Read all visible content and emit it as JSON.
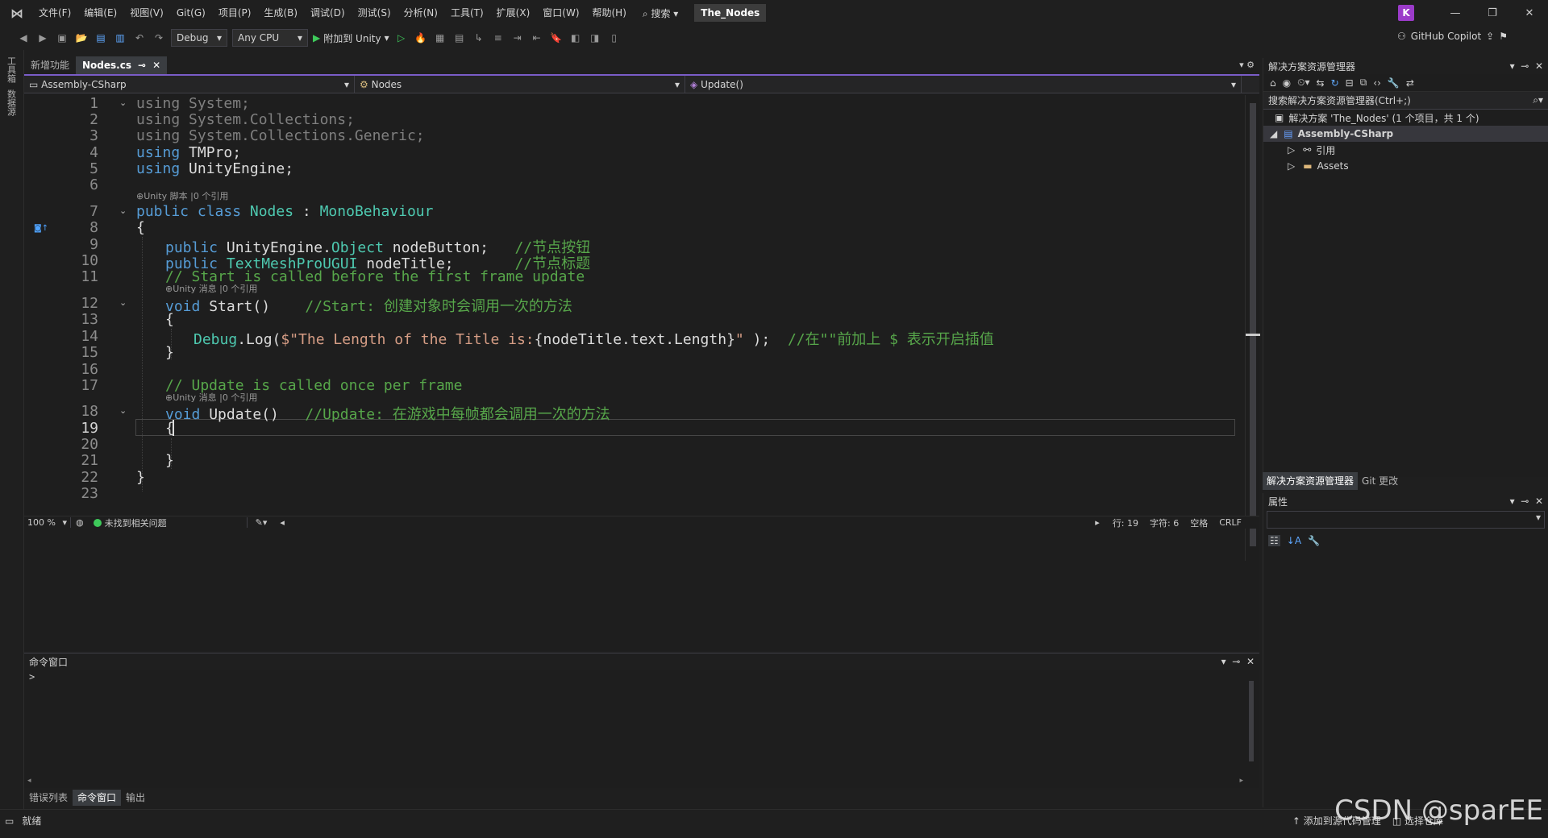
{
  "menu": [
    "文件(F)",
    "编辑(E)",
    "视图(V)",
    "Git(G)",
    "项目(P)",
    "生成(B)",
    "调试(D)",
    "测试(S)",
    "分析(N)",
    "工具(T)",
    "扩展(X)",
    "窗口(W)",
    "帮助(H)"
  ],
  "search_label": "搜索",
  "solution_title": "The_Nodes",
  "avatar_letter": "K",
  "toolbar": {
    "config": "Debug",
    "platform": "Any CPU",
    "attach": "附加到 Unity",
    "copilot": "GitHub Copilot"
  },
  "left_strip": [
    "工具箱",
    "数据源"
  ],
  "tabs": {
    "new_features": "新增功能",
    "file": "Nodes.cs"
  },
  "navbar": {
    "project": "Assembly-CSharp",
    "type": "Nodes",
    "member": "Update()"
  },
  "lens": {
    "class": "Unity 脚本 |0 个引用",
    "start": "Unity 消息 |0 个引用",
    "update": "Unity 消息 |0 个引用"
  },
  "code_lines": [
    {
      "n": "1"
    },
    {
      "n": "2"
    },
    {
      "n": "3"
    },
    {
      "n": "4"
    },
    {
      "n": "5"
    },
    {
      "n": "6"
    },
    {
      "n": "7"
    },
    {
      "n": "8"
    },
    {
      "n": "9"
    },
    {
      "n": "10"
    },
    {
      "n": "11"
    },
    {
      "n": "12"
    },
    {
      "n": "13"
    },
    {
      "n": "14"
    },
    {
      "n": "15"
    },
    {
      "n": "16"
    },
    {
      "n": "17"
    },
    {
      "n": "18"
    },
    {
      "n": "19"
    },
    {
      "n": "20"
    },
    {
      "n": "21"
    },
    {
      "n": "22"
    },
    {
      "n": "23"
    }
  ],
  "code": {
    "l1_kw": "using",
    "l1_rest": " System;",
    "l2_kw": "using",
    "l2_rest": " System.Collections;",
    "l3_kw": "using",
    "l3_rest": " System.Collections.Generic;",
    "l4_kw": "using",
    "l4_rest": " TMPro;",
    "l5_kw": "using",
    "l5_rest": " UnityEngine;",
    "l7_kw": "public class",
    "l7_name": " Nodes",
    "l7_colon": " : ",
    "l7_base": "MonoBehaviour",
    "l8": "{",
    "l9_kw": "public",
    "l9_ns": " UnityEngine.",
    "l9_ty": "Object",
    "l9_rest": " nodeButton;   ",
    "l9_cm": "//节点按钮",
    "l10_kw": "public",
    "l10_ty": " TextMeshProUGUI",
    "l10_rest": " nodeTitle;       ",
    "l10_cm": "//节点标题",
    "l11_cm": "// Start is called before the first frame update",
    "l12_kw": "void",
    "l12_rest": " Start()    ",
    "l12_cm": "//Start: 创建对象时会调用一次的方法",
    "l13": "{",
    "l14_ty": "Debug",
    "l14_a": ".Log(",
    "l14_st": "$\"The Length of the Title is:",
    "l14_b": "{nodeTitle.text.Length}",
    "l14_st2": "\"",
    "l14_c": " );  ",
    "l14_cm": "//在\"\"前加上 $ 表示开启插值",
    "l15": "}",
    "l17_cm": "// Update is called once per frame",
    "l18_kw": "void",
    "l18_rest": " Update()   ",
    "l18_cm": "//Update: 在游戏中每帧都会调用一次的方法",
    "l19": "{",
    "l21": "}",
    "l22": "}"
  },
  "editor_status": {
    "zoom": "100 %",
    "issues": "未找到相关问题",
    "line": "行: 19",
    "char": "字符: 6",
    "ws": "空格",
    "eol": "CRLF"
  },
  "cmd_window": {
    "title": "命令窗口",
    "prompt": ">"
  },
  "bottom_tabs": [
    "错误列表",
    "命令窗口",
    "输出"
  ],
  "solution_explorer": {
    "title": "解决方案资源管理器",
    "search_placeholder": "搜索解决方案资源管理器(Ctrl+;)",
    "solution": "解决方案 'The_Nodes' (1 个项目，共 1 个)",
    "project": "Assembly-CSharp",
    "references": "引用",
    "assets": "Assets"
  },
  "sol_tabs": [
    "解决方案资源管理器",
    "Git 更改"
  ],
  "properties_title": "属性",
  "status": {
    "ready": "就绪",
    "add_source": "添加到源代码管理",
    "select_repo": "选择仓库"
  },
  "watermark": "CSDN @sparEE"
}
